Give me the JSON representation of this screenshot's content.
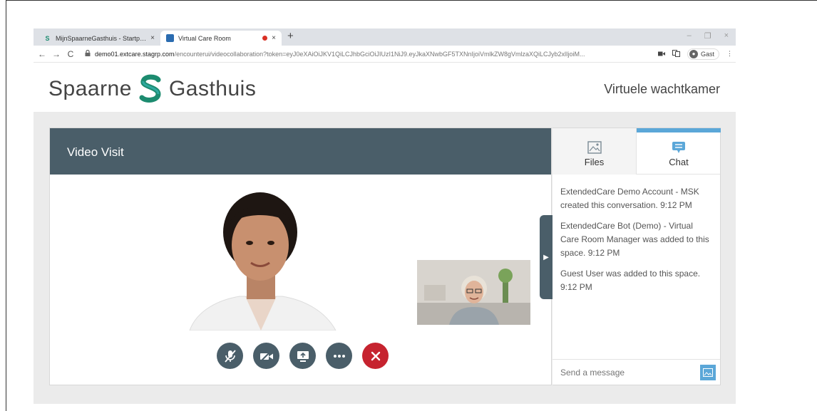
{
  "browser": {
    "tabs": [
      {
        "title": "MijnSpaarneGasthuis - Startpagi",
        "close": "×"
      },
      {
        "title": "Virtual Care Room",
        "close": "×"
      }
    ],
    "new_tab": "+",
    "window_controls": [
      "–",
      "❐",
      "×"
    ],
    "url_host": "demo01.extcare.stagrp.com",
    "url_path": "/encounterui/videocollaboration?token=eyJ0eXAiOiJKV1QiLCJhbGciOiJIUzI1NiJ9.eyJkaXNwbGF5TXNnIjoiVmlkZW8gVmlzaXQiLCJyb2xlIjoiM...",
    "profile_label": "Gast"
  },
  "header": {
    "brand_left": "Spaarne",
    "brand_right": "Gasthuis",
    "waiting_room": "Virtuele wachtkamer"
  },
  "visit": {
    "title": "Video Visit"
  },
  "chat": {
    "tab_files": "Files",
    "tab_chat": "Chat",
    "messages": [
      "ExtendedCare Demo Account - MSK created this conversation. 9:12 PM",
      "ExtendedCare Bot (Demo) - Virtual Care Room Manager was added to this space. 9:12 PM",
      "Guest User was added to this space. 9:12 PM"
    ],
    "input_placeholder": "Send a message"
  },
  "colors": {
    "header_slate": "#4a5e69",
    "accent_blue": "#5ba7d8",
    "end_call_red": "#c6232f",
    "brand_green": "#1c8b6f"
  },
  "icons": {
    "controls": [
      "mute-mic-icon",
      "camera-off-icon",
      "share-screen-icon",
      "more-icon",
      "end-call-icon"
    ]
  }
}
